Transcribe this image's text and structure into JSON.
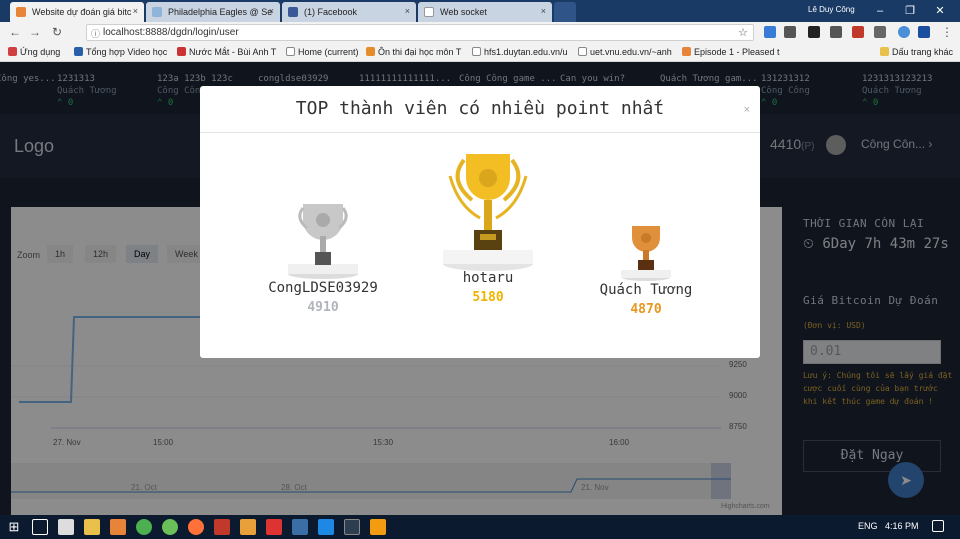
{
  "tabs": [
    {
      "label": "Website dự đoán giá bitc",
      "active": true,
      "color": "#e8833a"
    },
    {
      "label": "Philadelphia Eagles @ Se",
      "active": false,
      "color": "#8fb3d9"
    },
    {
      "label": "(1) Facebook",
      "active": false,
      "color": "#3b5998"
    },
    {
      "label": "Web socket",
      "active": false,
      "color": "#999999"
    }
  ],
  "window_user": "Lê Duy Công",
  "address": {
    "url": "localhost:8888/dgdn/login/user"
  },
  "bookmarks": [
    {
      "label": "Ứng dụng",
      "color": "#d04040"
    },
    {
      "label": "Tổng hợp Video học",
      "color": "#2a5ea8"
    },
    {
      "label": "Nước Mắt - Bùi Anh T",
      "color": "#cc3333"
    },
    {
      "label": "Home (current)",
      "color": "#888888"
    },
    {
      "label": "Ôn thi đại học môn T",
      "color": "#e58c2a"
    },
    {
      "label": "hfs1.duytan.edu.vn/u",
      "color": "#888888"
    },
    {
      "label": "uet.vnu.edu.vn/~anh",
      "color": "#888888"
    },
    {
      "label": "Episode 1 - Pleased t",
      "color": "#e8833a"
    },
    {
      "label": "Dấu trang khác",
      "color": "#e8c04a"
    }
  ],
  "ticker": [
    {
      "title": "Công yes...",
      "sub": "",
      "val": ""
    },
    {
      "title": "1231313",
      "sub": "Quách Tương",
      "val": "⌃ 0"
    },
    {
      "title": "123a 123b 123c",
      "sub": "Công Côn",
      "val": "⌃ 0"
    },
    {
      "title": "congldse03929",
      "sub": "",
      "val": ""
    },
    {
      "title": "11111111111111...",
      "sub": "",
      "val": ""
    },
    {
      "title": "Công Công game ...",
      "sub": "",
      "val": ""
    },
    {
      "title": "Can you win?",
      "sub": "",
      "val": ""
    },
    {
      "title": "Quách Tương gam...",
      "sub": "",
      "val": ""
    },
    {
      "title": "131231312",
      "sub": "Công Công",
      "val": "⌃ 0"
    },
    {
      "title": "1231313123213",
      "sub": "Quách Tương",
      "val": "⌃ 0"
    }
  ],
  "header": {
    "logo": "Logo",
    "points_value": "4410",
    "points_unit": "(P)",
    "username": "Công Côn..."
  },
  "chart": {
    "zoom_label": "Zoom",
    "zoom_buttons": [
      "1h",
      "12h",
      "Day",
      "Week"
    ],
    "selected_zoom": "Day",
    "y_ticks": [
      "9250",
      "9000",
      "8750"
    ],
    "x_ticks": [
      "27. Nov",
      "15:00",
      "15:30",
      "16:00"
    ],
    "navigator_labels": [
      "21. Oct",
      "28. Oct",
      "21. Nov"
    ],
    "credit": "Highcharts.com"
  },
  "sidebar": {
    "time_left_label": "THỜI GIAN CÒN LẠI",
    "countdown": "6Day 7h 43m 27s",
    "price_label": "Giá Bitcoin Dự Đoán",
    "unit_label": "(Đơn vị: USD)",
    "price_placeholder": "0.01",
    "note": "Lưu ý: Chúng tôi sẽ lấy giá đặt cược cuối cùng của bạn trước khi kết thúc game dự đoán !",
    "bet_button": "Đặt Ngay"
  },
  "modal": {
    "title": "TOP thành viên có nhiều point nhất",
    "close": "×",
    "ranks": [
      {
        "place": 2,
        "name": "CongLDSE03929",
        "points": "4910",
        "color": "#b0b4bb"
      },
      {
        "place": 1,
        "name": "hotaru",
        "points": "5180",
        "color": "#f0b400"
      },
      {
        "place": 3,
        "name": "Quách Tương",
        "points": "4870",
        "color": "#e8961e"
      }
    ]
  },
  "taskbar": {
    "language": "ENG",
    "time": "4:16 PM"
  }
}
